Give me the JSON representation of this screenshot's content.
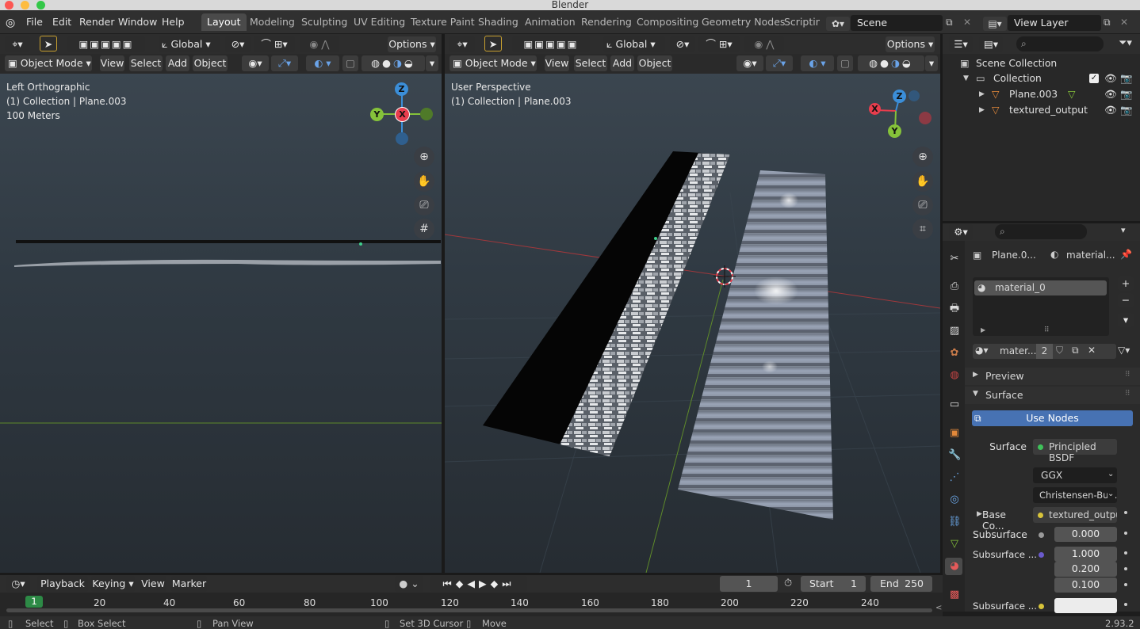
{
  "window": {
    "title": "Blender"
  },
  "menubar": {
    "menus": [
      "File",
      "Edit",
      "Render",
      "Window",
      "Help"
    ],
    "workspaces": [
      "Layout",
      "Modeling",
      "Sculpting",
      "UV Editing",
      "Texture Paint",
      "Shading",
      "Animation",
      "Rendering",
      "Compositing",
      "Geometry Nodes",
      "Scripting"
    ],
    "active_workspace": "Layout",
    "scene": "Scene",
    "view_layer": "View Layer"
  },
  "left_viewport": {
    "transform_orientation": "Global",
    "options": "Options",
    "mode": "Object Mode",
    "menus": [
      "View",
      "Select",
      "Add",
      "Object"
    ],
    "overlay_lines": [
      "Left Orthographic",
      "(1) Collection | Plane.003",
      "100 Meters"
    ],
    "gizmo": {
      "top": "Z",
      "left": "Y",
      "center": "X"
    }
  },
  "right_viewport": {
    "transform_orientation": "Global",
    "options": "Options",
    "mode": "Object Mode",
    "menus": [
      "View",
      "Select",
      "Add",
      "Object"
    ],
    "overlay_lines": [
      "User Perspective",
      "(1) Collection | Plane.003"
    ],
    "gizmo": {
      "top": "Z",
      "left": "X",
      "bottom": "Y"
    }
  },
  "outliner": {
    "root": "Scene Collection",
    "collection": "Collection",
    "items": [
      "Plane.003",
      "textured_output"
    ]
  },
  "properties": {
    "breadcrumb_object": "Plane.0...",
    "breadcrumb_material": "material...",
    "material_slot": "material_0",
    "datablock_name": "mater...",
    "user_count": "2",
    "panels": {
      "preview": "Preview",
      "surface": "Surface"
    },
    "use_nodes": "Use Nodes",
    "surface": {
      "label": "Surface",
      "value": "Principled BSDF"
    },
    "distribution": "GGX",
    "subsurface_method": "Christensen-Bur...",
    "base_color": {
      "label": "Base Co...",
      "value": "textured_outpu..."
    },
    "subsurface": {
      "label": "Subsurface",
      "value": "0.000"
    },
    "subsurface_radius": {
      "label": "Subsurface ...",
      "values": [
        "1.000",
        "0.200",
        "0.100"
      ]
    },
    "subsurface_color": {
      "label": "Subsurface ..."
    }
  },
  "timeline": {
    "menus": [
      "Playback",
      "Keying",
      "View",
      "Marker"
    ],
    "current_frame": "1",
    "start_label": "Start",
    "start": "1",
    "end_label": "End",
    "end": "250",
    "ticks": [
      "20",
      "40",
      "60",
      "80",
      "100",
      "120",
      "140",
      "160",
      "180",
      "200",
      "220",
      "240"
    ],
    "playhead": "1"
  },
  "statusbar": {
    "items": [
      "Select",
      "Box Select",
      "Pan View",
      "Set 3D Cursor",
      "Move"
    ],
    "version": "2.93.2"
  },
  "colors": {
    "accent": "#4772b3",
    "axis_x": "#e83d4d",
    "axis_y": "#85c23a",
    "axis_z": "#3b8ed8"
  }
}
